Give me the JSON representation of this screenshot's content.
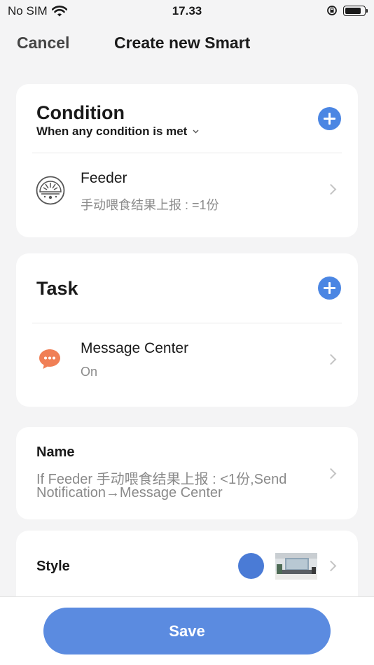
{
  "status": {
    "carrier": "No SIM",
    "time": "17.33"
  },
  "nav": {
    "cancel": "Cancel",
    "title": "Create new Smart"
  },
  "condition": {
    "title": "Condition",
    "match": "When any condition is met",
    "item": {
      "device": "Feeder",
      "detail": "手动喂食结果上报 : =1份",
      "icon": "feeder-icon"
    }
  },
  "task": {
    "title": "Task",
    "item": {
      "device": "Message Center",
      "detail": "On",
      "icon": "message-icon"
    }
  },
  "name": {
    "label": "Name",
    "line1": "If Feeder  手动喂食结果上报 : <1份,Send",
    "line2": "Notification→Message Center"
  },
  "style": {
    "label": "Style",
    "color": "#4a7bd6"
  },
  "save": {
    "label": "Save"
  },
  "colors": {
    "accent": "#4b86e3",
    "save": "#5b8be0",
    "message": "#f07f56"
  }
}
